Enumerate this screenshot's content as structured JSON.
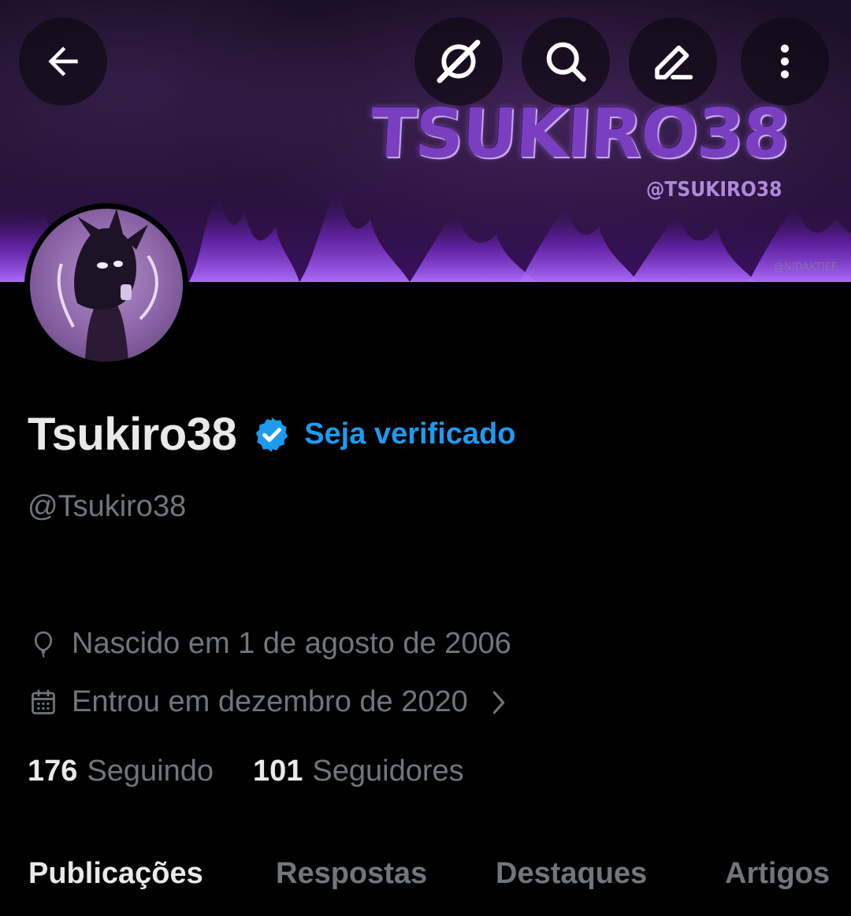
{
  "header": {
    "back_icon": "arrow-left-icon",
    "actions": [
      "grok-icon",
      "search-icon",
      "edit-icon",
      "more-vertical-icon"
    ],
    "banner": {
      "title": "TSUKIRO38",
      "handle": "@TSUKIRO38",
      "credit": "@NIDAKTIEF"
    }
  },
  "profile": {
    "name": "Tsukiro38",
    "get_verified": "Seja verificado",
    "handle": "@Tsukiro38",
    "birthday": "Nascido em 1 de agosto de 2006",
    "joined": "Entrou em dezembro de 2020",
    "following_count": "176",
    "following_label": "Seguindo",
    "followers_count": "101",
    "followers_label": "Seguidores"
  },
  "tabs": [
    {
      "label": "Publicações",
      "active": true
    },
    {
      "label": "Respostas",
      "active": false
    },
    {
      "label": "Destaques",
      "active": false
    },
    {
      "label": "Artigos",
      "active": false
    }
  ],
  "colors": {
    "background": "#000000",
    "accent": "#1d9bf0",
    "text_primary": "#e7e9ea",
    "text_secondary": "#71767b",
    "banner_purple": "#7a3fc0"
  }
}
